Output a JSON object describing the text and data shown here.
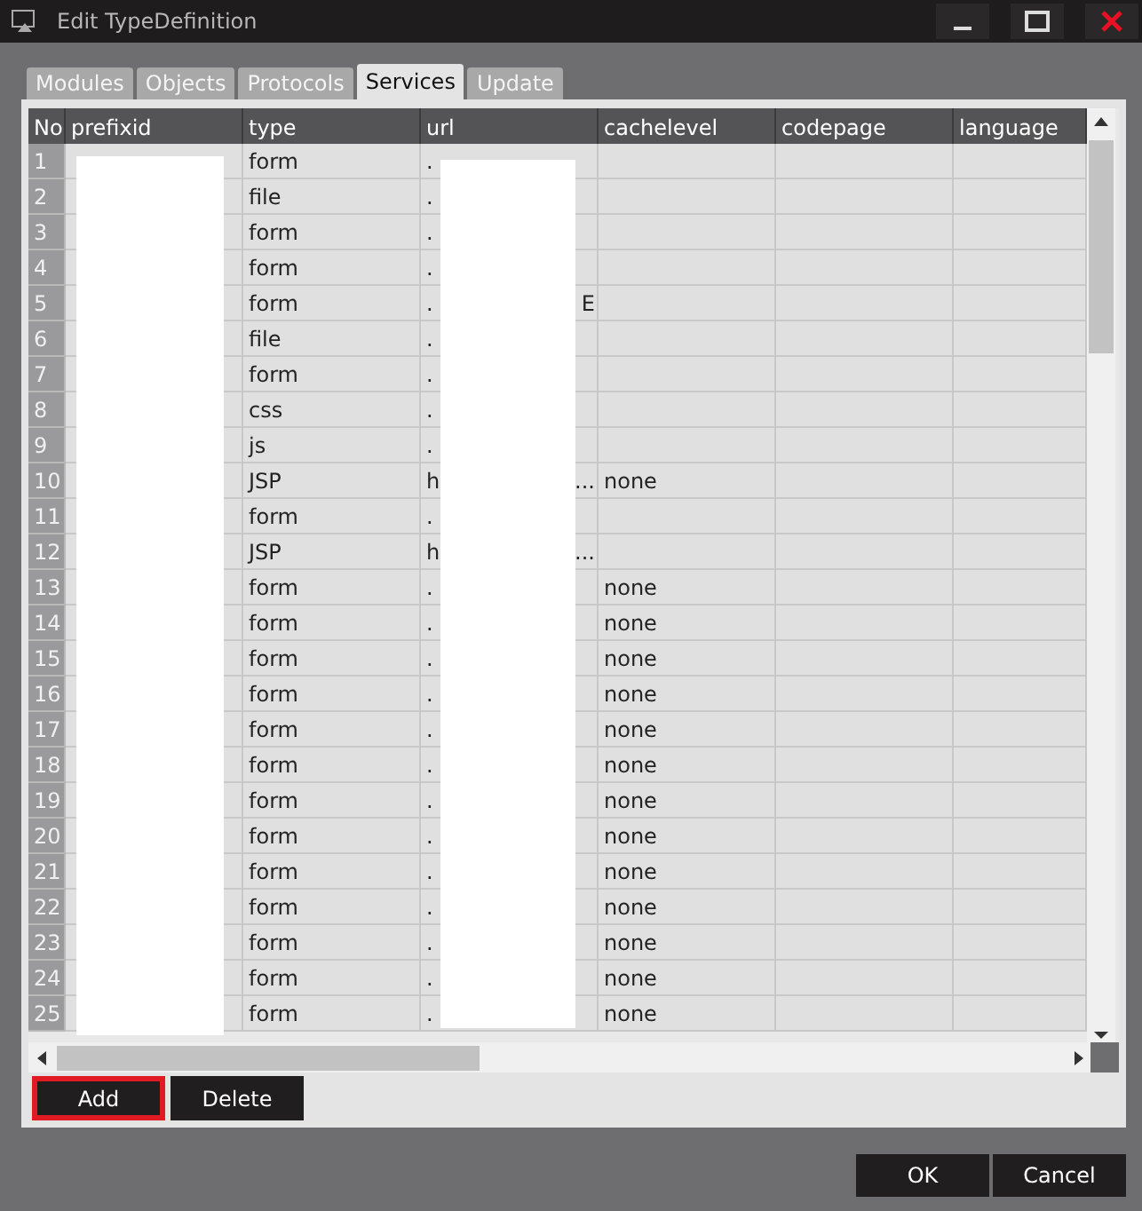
{
  "window": {
    "title": "Edit TypeDefinition"
  },
  "tabs": [
    {
      "label": "Modules",
      "selected": false
    },
    {
      "label": "Objects",
      "selected": false
    },
    {
      "label": "Protocols",
      "selected": false
    },
    {
      "label": "Services",
      "selected": true
    },
    {
      "label": "Update",
      "selected": false
    }
  ],
  "table": {
    "columns": [
      "No",
      "prefixid",
      "type",
      "url",
      "cachelevel",
      "codepage",
      "language"
    ],
    "rows": [
      {
        "no": "1",
        "type": "form",
        "url_start": "."
      },
      {
        "no": "2",
        "type": "file",
        "url_start": "."
      },
      {
        "no": "3",
        "type": "form",
        "url_start": "."
      },
      {
        "no": "4",
        "type": "form",
        "url_start": "."
      },
      {
        "no": "5",
        "type": "form",
        "url_start": ".",
        "url_end": "E"
      },
      {
        "no": "6",
        "type": "file",
        "url_start": "."
      },
      {
        "no": "7",
        "type": "form",
        "url_start": "."
      },
      {
        "no": "8",
        "type": "css",
        "url_start": "."
      },
      {
        "no": "9",
        "type": "js",
        "url_start": "."
      },
      {
        "no": "10",
        "type": "JSP",
        "url_start": "h",
        "url_end": "...",
        "cachelevel": "none"
      },
      {
        "no": "11",
        "type": "form",
        "url_start": "."
      },
      {
        "no": "12",
        "type": "JSP",
        "url_start": "h",
        "url_end": "..."
      },
      {
        "no": "13",
        "type": "form",
        "url_start": ".",
        "cachelevel": "none"
      },
      {
        "no": "14",
        "type": "form",
        "url_start": ".",
        "cachelevel": "none"
      },
      {
        "no": "15",
        "type": "form",
        "url_start": ".",
        "cachelevel": "none"
      },
      {
        "no": "16",
        "type": "form",
        "url_start": ".",
        "cachelevel": "none"
      },
      {
        "no": "17",
        "type": "form",
        "url_start": ".",
        "cachelevel": "none"
      },
      {
        "no": "18",
        "type": "form",
        "url_start": ".",
        "cachelevel": "none"
      },
      {
        "no": "19",
        "type": "form",
        "url_start": ".",
        "cachelevel": "none"
      },
      {
        "no": "20",
        "type": "form",
        "url_start": ".",
        "cachelevel": "none"
      },
      {
        "no": "21",
        "type": "form",
        "url_start": ".",
        "cachelevel": "none"
      },
      {
        "no": "22",
        "type": "form",
        "url_start": ".",
        "cachelevel": "none"
      },
      {
        "no": "23",
        "type": "form",
        "url_start": ".",
        "cachelevel": "none"
      },
      {
        "no": "24",
        "type": "form",
        "url_start": ".",
        "cachelevel": "none"
      },
      {
        "no": "25",
        "type": "form",
        "url_start": ".",
        "cachelevel": "none"
      }
    ]
  },
  "grid_buttons": [
    {
      "label": "Add",
      "selected": true
    },
    {
      "label": "Delete",
      "selected": false
    }
  ],
  "dialog_buttons": [
    "OK",
    "Cancel"
  ]
}
